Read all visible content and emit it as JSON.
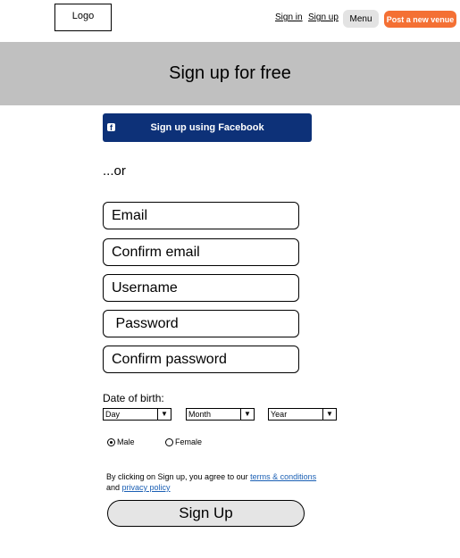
{
  "header": {
    "logo": "Logo",
    "sign_in": "Sign in",
    "sign_up": "Sign up",
    "menu": "Menu",
    "post_venue": "Post a new venue"
  },
  "banner": {
    "title": "Sign up for free"
  },
  "facebook": {
    "label": "Sign up using Facebook",
    "icon": "facebook-icon",
    "color": "#0d3178"
  },
  "or_text": "...or",
  "form": {
    "email_placeholder": "Email",
    "confirm_email_placeholder": "Confirm email",
    "username_placeholder": "Username",
    "password_placeholder": " Password",
    "confirm_password_placeholder": "Confirm password"
  },
  "dob": {
    "label": "Date of birth:",
    "day": "Day",
    "month": "Month",
    "year": "Year"
  },
  "gender": {
    "male": "Male",
    "female": "Female",
    "selected": "Male"
  },
  "terms": {
    "text_before": "By clicking on Sign up, you agree to our ",
    "terms_link": "terms & conditions",
    "text_and": "and ",
    "privacy_link": "privacy policy"
  },
  "signup_button": "Sign Up",
  "colors": {
    "accent": "#f47034",
    "banner": "#c0c0c0"
  }
}
